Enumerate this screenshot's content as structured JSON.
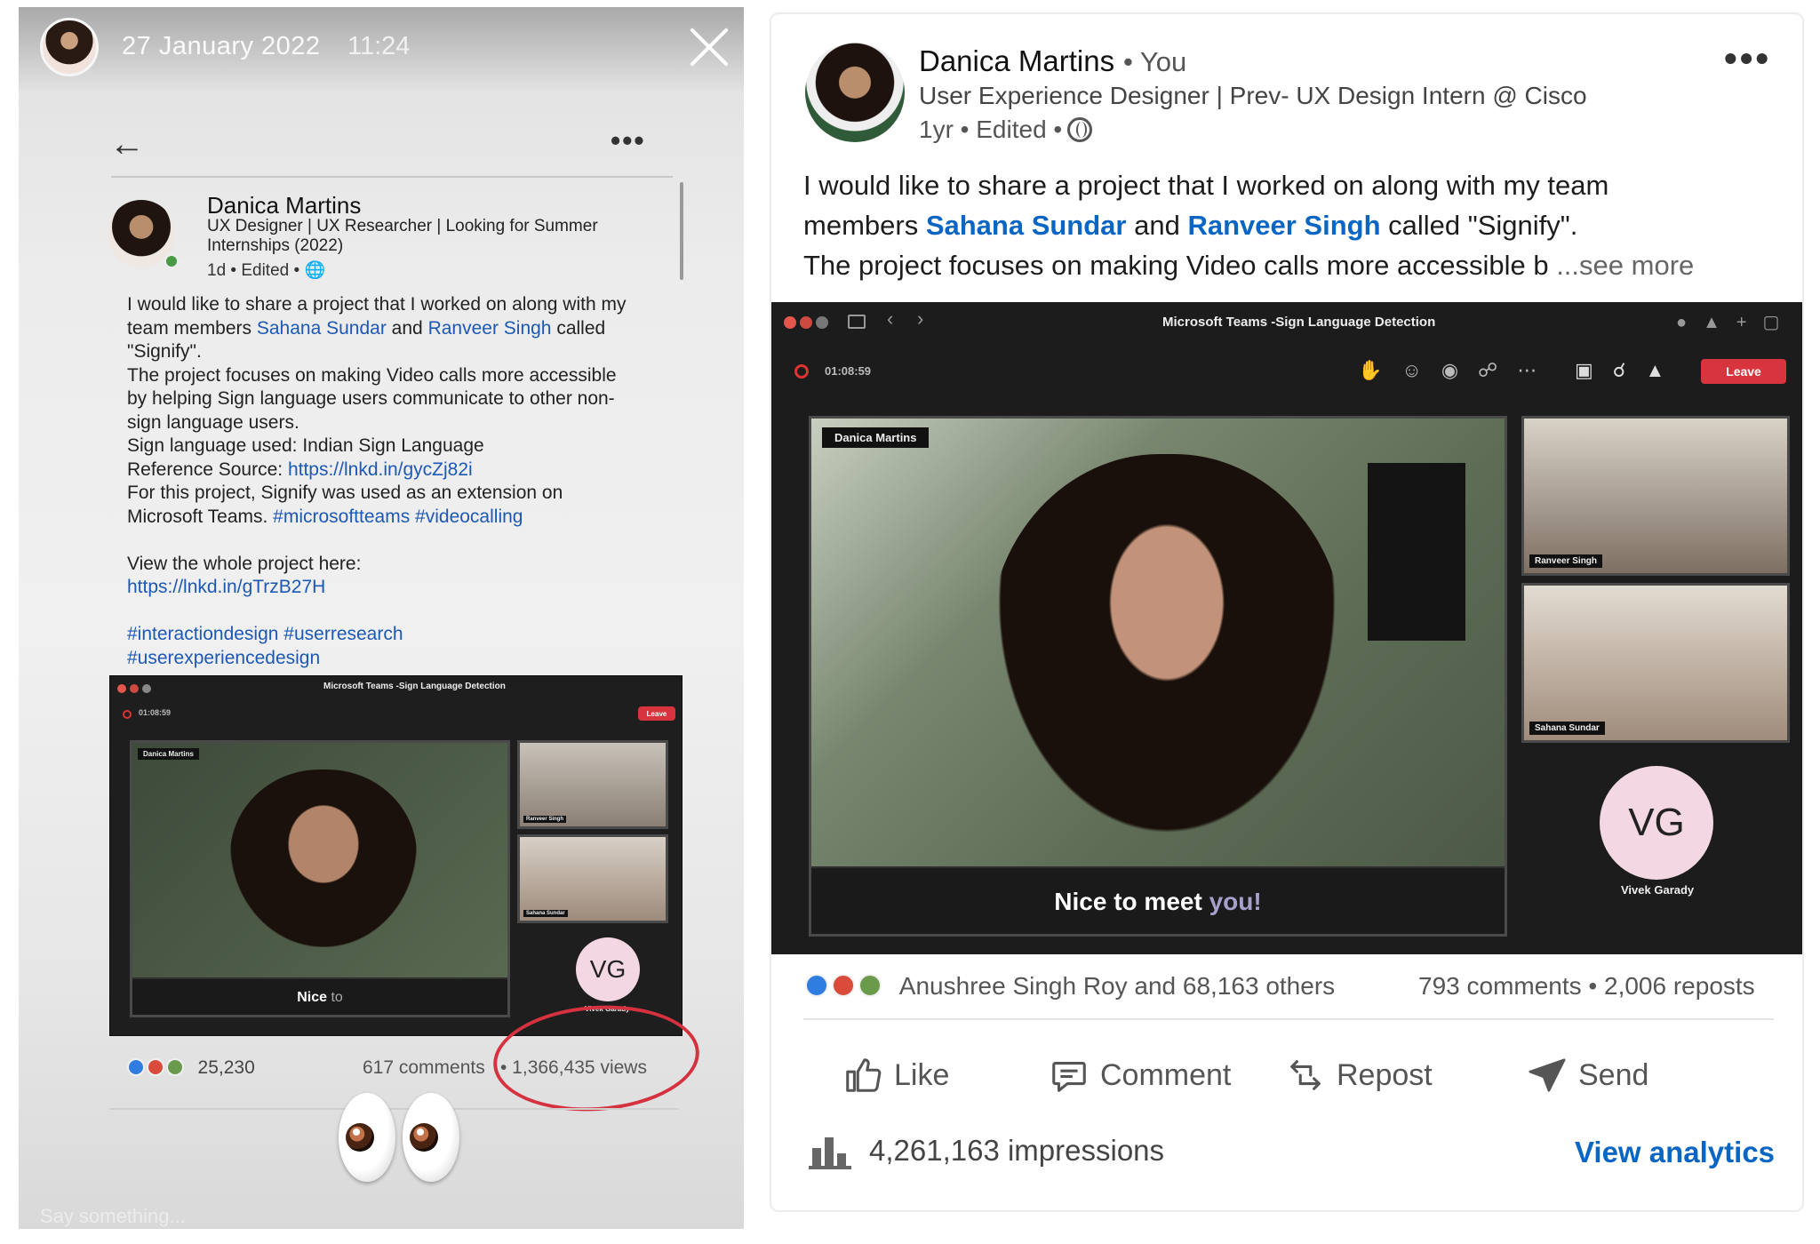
{
  "story": {
    "date": "27 January 2022",
    "time": "11:24",
    "footer_hint": "Say something..."
  },
  "story_post": {
    "author": "Danica Martins",
    "headline": "UX Designer | UX Researcher | Looking for Summer Internships (2022)",
    "meta": "1d • Edited •",
    "body_lines": [
      {
        "pre": "I would like to share a project that I worked on along with my",
        "link1": "",
        "mid": "",
        "link2": "",
        "post": ""
      },
      {
        "pre": "team members ",
        "link1": "Sahana Sundar",
        "mid": " and ",
        "link2": "Ranveer Singh",
        "post": " called"
      },
      {
        "pre": "\"Signify\".",
        "link1": "",
        "mid": "",
        "link2": "",
        "post": ""
      },
      {
        "pre": "The project focuses on making Video calls more accessible",
        "link1": "",
        "mid": "",
        "link2": "",
        "post": ""
      },
      {
        "pre": "by helping Sign language users communicate to other non-",
        "link1": "",
        "mid": "",
        "link2": "",
        "post": ""
      },
      {
        "pre": "sign language users.",
        "link1": "",
        "mid": "",
        "link2": "",
        "post": ""
      },
      {
        "pre": "Sign language used: Indian Sign Language",
        "link1": "",
        "mid": "",
        "link2": "",
        "post": ""
      },
      {
        "pre": "Reference Source: ",
        "link1": "https://lnkd.in/gycZj82i",
        "mid": "",
        "link2": "",
        "post": ""
      },
      {
        "pre": "For this project, Signify was used as an extension on",
        "link1": "",
        "mid": "",
        "link2": "",
        "post": ""
      },
      {
        "pre": "Microsoft Teams. ",
        "link1": "#microsoftteams",
        "mid": " ",
        "link2": "#videocalling",
        "post": ""
      },
      {
        "pre": "",
        "link1": "",
        "mid": "",
        "link2": "",
        "post": ""
      },
      {
        "pre": "View the whole project here:",
        "link1": "",
        "mid": "",
        "link2": "",
        "post": ""
      },
      {
        "pre": "",
        "link1": "https://lnkd.in/gTrzB27H",
        "mid": "",
        "link2": "",
        "post": ""
      },
      {
        "pre": "",
        "link1": "",
        "mid": "",
        "link2": "",
        "post": ""
      },
      {
        "pre": "",
        "link1": "#interactiondesign",
        "mid": "  ",
        "link2": "#userresearch",
        "post": ""
      },
      {
        "pre": "",
        "link1": "#userexperiencedesign",
        "mid": "",
        "link2": "",
        "post": ""
      }
    ],
    "reactions_count": "25,230",
    "comments": "617 comments",
    "views": "• 1,366,435 views",
    "video": {
      "window_title": "Microsoft Teams -Sign Language Detection",
      "timer": "01:08:59",
      "leave": "Leave",
      "main_label": "Danica Martins",
      "caption_white": "Nice",
      "caption_grey": "to",
      "tile1_label": "Ranveer Singh",
      "tile2_label": "Sahana Sundar",
      "vg_initials": "VG",
      "vg_name": "Vivek Garady"
    }
  },
  "post": {
    "author": "Danica Martins",
    "you": "• You",
    "headline": "User Experience Designer | Prev- UX Design Intern @ Cisco",
    "meta": "1yr • Edited •",
    "body_line1": "I would like to share a project that I worked on along with my team",
    "body_line2_pre": "members ",
    "mention1": "Sahana Sundar",
    "body_line2_mid": " and ",
    "mention2": "Ranveer Singh",
    "body_line2_post": " called \"Signify\".",
    "body_line3": "The project focuses on making Video calls more accessible b",
    "see_more": " ...see more",
    "video": {
      "window_title": "Microsoft Teams -Sign Language Detection",
      "timer": "01:08:59",
      "leave": "Leave",
      "main_label": "Danica Martins",
      "caption_white": "Nice to meet",
      "caption_grey": "you!",
      "tile1_label": "Ranveer Singh",
      "tile2_label": "Sahana Sundar",
      "vg_initials": "VG",
      "vg_name": "Vivek Garady"
    },
    "reactions_text": "Anushree Singh Roy and 68,163 others",
    "comments_reposts": "793 comments • 2,006 reposts",
    "actions": {
      "like": "Like",
      "comment": "Comment",
      "repost": "Repost",
      "send": "Send"
    },
    "impressions": "4,261,163 impressions",
    "view_analytics": "View analytics"
  },
  "colors": {
    "linkedin_blue": "#0a66c2",
    "annotation_red": "#d5313e",
    "teams_leave": "#d8343e",
    "vg_avatar": "#f3d8e3"
  }
}
